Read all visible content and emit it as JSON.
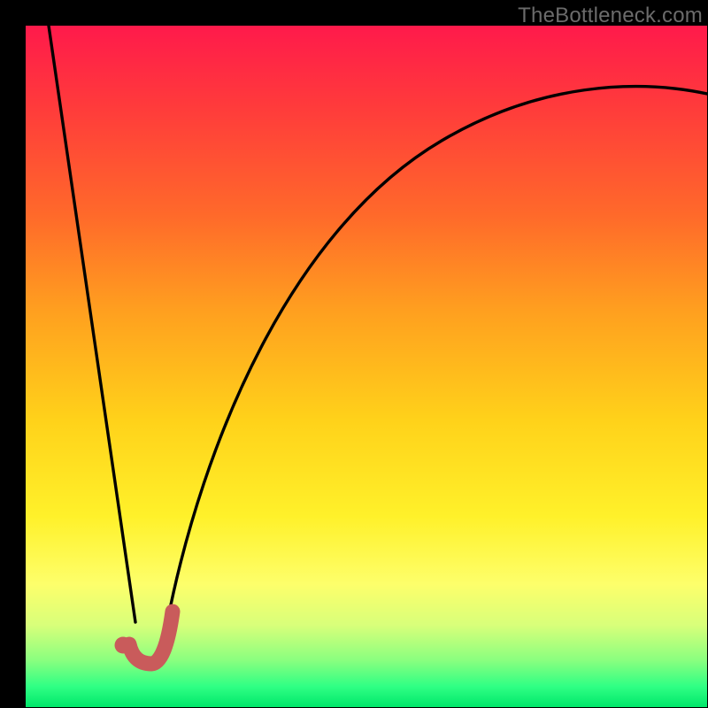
{
  "watermark": "TheBottleneck.com",
  "chart_data": {
    "type": "line",
    "title": "",
    "xlabel": "",
    "ylabel": "",
    "xlim": [
      0,
      100
    ],
    "ylim": [
      0,
      100
    ],
    "grid": false,
    "legend": false,
    "note": "Bottleneck-percentage style curve; no numeric axis ticks are rendered. Values estimated from gradient (0 = green/bottom, 100 = red/top).",
    "series": [
      {
        "name": "left-branch",
        "x": [
          3.4,
          6,
          9,
          12,
          14.5,
          16.1
        ],
        "y": [
          100,
          82,
          62,
          41,
          24,
          12.5
        ]
      },
      {
        "name": "right-branch",
        "x": [
          20.8,
          23,
          26,
          30,
          35,
          42,
          50,
          60,
          72,
          85,
          100
        ],
        "y": [
          12.5,
          21,
          33,
          46,
          58,
          69,
          77,
          83,
          87,
          89,
          90
        ]
      },
      {
        "name": "marker-hook-red",
        "x": [
          15.2,
          16.1,
          17.4,
          18.6,
          19.9,
          20.8,
          21.6
        ],
        "y": [
          9.2,
          7.3,
          6.5,
          6.8,
          8.2,
          11.0,
          14.0
        ]
      },
      {
        "name": "marker-dot-red",
        "x": [
          14.3
        ],
        "y": [
          9.0
        ]
      }
    ],
    "colors": {
      "curve": "#000000",
      "marker": "#c95b5b"
    }
  }
}
